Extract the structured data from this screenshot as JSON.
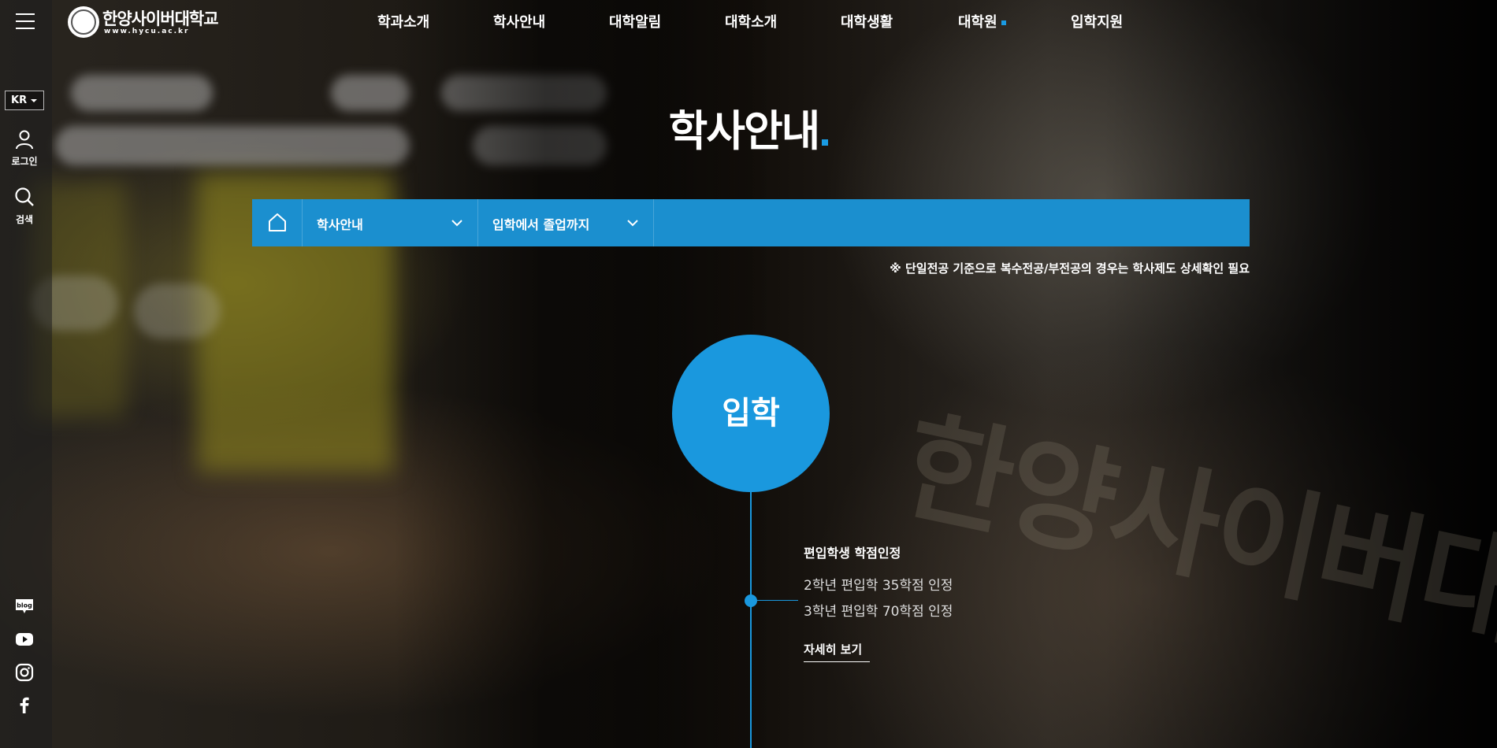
{
  "header": {
    "logo": {
      "name": "한양사이버대학교",
      "url": "www.hycu.ac.kr"
    },
    "nav": [
      {
        "label": "학과소개"
      },
      {
        "label": "학사안내"
      },
      {
        "label": "대학알림"
      },
      {
        "label": "대학소개"
      },
      {
        "label": "대학생활"
      },
      {
        "label": "대학원",
        "accent_dot": true
      },
      {
        "label": "입학지원"
      }
    ]
  },
  "sidebar": {
    "menu_icon": "hamburger-icon",
    "language": "KR",
    "login_label": "로그인",
    "search_label": "검색",
    "social": [
      "blog-icon",
      "youtube-icon",
      "instagram-icon",
      "facebook-icon"
    ],
    "blog_text": "blog"
  },
  "page": {
    "title": "학사안내"
  },
  "breadcrumb": {
    "home_icon": "home-icon",
    "level1": "학사안내",
    "level2": "입학에서 졸업까지"
  },
  "notice": "※ 단일전공 기준으로 복수전공/부전공의 경우는 학사제도 상세확인 필요",
  "timeline": {
    "stage": "입학",
    "item": {
      "title": "편입학생 학점인정",
      "lines": [
        "2학년 편입학 35학점 인정",
        "3학년 편입학 70학점 인정"
      ],
      "link": "자세히 보기"
    }
  },
  "background": {
    "wall_text": "한양사이버대학교"
  },
  "colors": {
    "accent": "#1a98de",
    "breadcrumb_bar": "#1b8fcf"
  }
}
